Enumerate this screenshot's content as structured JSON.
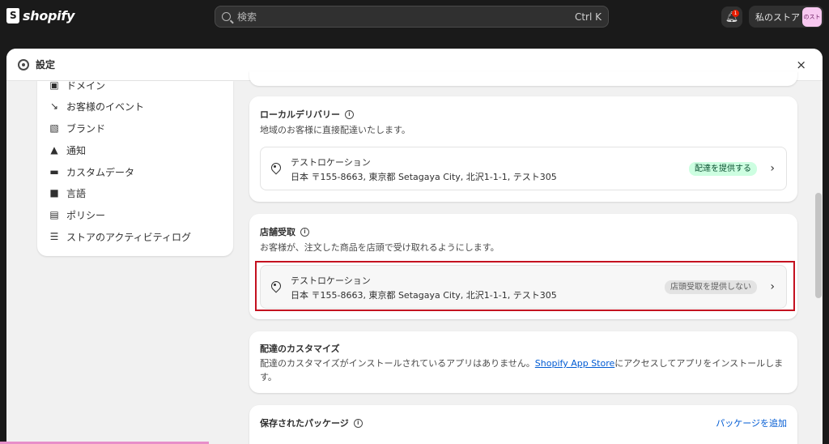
{
  "brand": {
    "name": "shopify"
  },
  "topbar": {
    "search_placeholder": "検索",
    "search_shortcut": "Ctrl K",
    "notification_count": "1",
    "store_name": "私のストア",
    "store_avatar": "のスト"
  },
  "modal": {
    "title": "設定",
    "close_label": "×"
  },
  "sidebar": {
    "items": [
      {
        "label": "ドメイン",
        "icon": "globe-icon"
      },
      {
        "label": "お客様のイベント",
        "icon": "cursor-click-icon"
      },
      {
        "label": "ブランド",
        "icon": "brand-icon"
      },
      {
        "label": "通知",
        "icon": "bell-icon"
      },
      {
        "label": "カスタムデータ",
        "icon": "database-icon"
      },
      {
        "label": "言語",
        "icon": "language-icon"
      },
      {
        "label": "ポリシー",
        "icon": "policy-icon"
      },
      {
        "label": "ストアのアクティビティログ",
        "icon": "list-icon"
      }
    ]
  },
  "local_delivery": {
    "title": "ローカルデリバリー",
    "description": "地域のお客様に直接配達いたします。",
    "location": {
      "name": "テストロケーション",
      "address": "日本 〒155-8663, 東京都 Setagaya City, 北沢1-1-1, テスト305",
      "status": "配達を提供する"
    }
  },
  "pickup": {
    "title": "店舗受取",
    "description": "お客様が、注文した商品を店頭で受け取れるようにします。",
    "location": {
      "name": "テストロケーション",
      "address": "日本 〒155-8663, 東京都 Setagaya City, 北沢1-1-1, テスト305",
      "status": "店頭受取を提供しない"
    }
  },
  "customization": {
    "title": "配達のカスタマイズ",
    "desc_before": "配達のカスタマイズがインストールされているアプリはありません。",
    "link": "Shopify App Store",
    "desc_after_line1": "にアクセスしてアプリをインストールしま",
    "desc_line2": "す。"
  },
  "packages": {
    "title": "保存されたパッケージ",
    "add_label": "パッケージを追加"
  },
  "colors": {
    "topbar": "#1a1a1a",
    "highlight_frame": "#c4101f",
    "active_badge": "#cdfee1",
    "link": "#005bd3"
  }
}
